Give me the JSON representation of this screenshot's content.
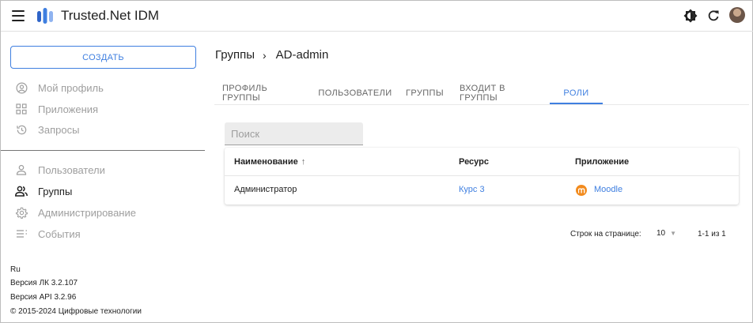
{
  "header": {
    "app_title": "Trusted.Net IDM",
    "icons": [
      "menu-icon",
      "app-logo",
      "theme-toggle-icon",
      "refresh-icon",
      "avatar"
    ]
  },
  "sidebar": {
    "create_label": "СОЗДАТЬ",
    "top_items": [
      {
        "label": "Мой профиль",
        "icon": "account-circle-icon"
      },
      {
        "label": "Приложения",
        "icon": "apps-grid-icon"
      },
      {
        "label": "Запросы",
        "icon": "history-icon"
      }
    ],
    "admin_items": [
      {
        "label": "Пользователи",
        "icon": "user-icon"
      },
      {
        "label": "Группы",
        "icon": "group-icon",
        "active": true
      },
      {
        "label": "Администрирование",
        "icon": "settings-icon"
      },
      {
        "label": "События",
        "icon": "events-list-icon"
      }
    ],
    "footer": {
      "lang": "Ru",
      "version_lk": "Версия ЛК 3.2.107",
      "version_api": "Версия API 3.2.96",
      "copyright": "© 2015-2024 Цифровые технологии"
    }
  },
  "main": {
    "breadcrumb": {
      "parent": "Группы",
      "separator": "›",
      "current": "AD-admin"
    },
    "tabs": [
      {
        "label": "ПРОФИЛЬ ГРУППЫ"
      },
      {
        "label": "ПОЛЬЗОВАТЕЛИ"
      },
      {
        "label": "ГРУППЫ"
      },
      {
        "label": "ВХОДИТ В ГРУППЫ"
      },
      {
        "label": "РОЛИ",
        "active": true
      }
    ],
    "search": {
      "placeholder": "Поиск",
      "value": ""
    },
    "table": {
      "columns": [
        "Наименование",
        "Ресурс",
        "Приложение"
      ],
      "sort_indicator": "↑",
      "rows": [
        {
          "name": "Администратор",
          "resource": "Курс 3",
          "app": "Moodle"
        }
      ]
    },
    "pagination": {
      "rows_per_page_label": "Строк на странице:",
      "rows_per_page_value": "10",
      "range": "1-1 из 1"
    }
  },
  "colors": {
    "accent": "#3f7fe0",
    "text": "#222222",
    "muted": "#9e9e9e",
    "moodle": "#f28b1e"
  }
}
